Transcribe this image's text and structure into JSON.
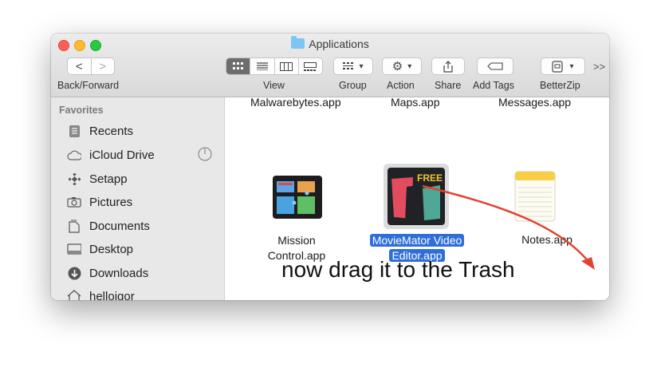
{
  "window": {
    "title": "Applications"
  },
  "toolbar": {
    "back_forward_label": "Back/Forward",
    "view_label": "View",
    "group_label": "Group",
    "action_label": "Action",
    "share_label": "Share",
    "add_tags_label": "Add Tags",
    "betterzip_label": "BetterZip",
    "overflow_label": ">>",
    "back_glyph": "<",
    "forward_glyph": ">"
  },
  "sidebar": {
    "section_title": "Favorites",
    "items": [
      {
        "label": "Recents",
        "icon": "recents-icon"
      },
      {
        "label": "iCloud Drive",
        "icon": "cloud-icon"
      },
      {
        "label": "Setapp",
        "icon": "setapp-icon"
      },
      {
        "label": "Pictures",
        "icon": "camera-icon"
      },
      {
        "label": "Documents",
        "icon": "document-icon"
      },
      {
        "label": "Desktop",
        "icon": "desktop-icon"
      },
      {
        "label": "Downloads",
        "icon": "download-icon"
      },
      {
        "label": "helloigor",
        "icon": "home-icon"
      }
    ]
  },
  "files": {
    "top_row": [
      "Malwarebytes.app",
      "Maps.app",
      "Messages.app"
    ],
    "mission_control": {
      "line1": "Mission",
      "line2": "Control.app"
    },
    "moviemator": {
      "line1": "MovieMator Video",
      "line2": "Editor.app",
      "badge": "FREE"
    },
    "notes": {
      "label": "Notes.app"
    }
  },
  "overlay": {
    "caption": "now drag it to the Trash",
    "arrow_color": "#e0432f"
  },
  "colors": {
    "selection": "#2f6ed8",
    "close": "#fc5f57",
    "minimize": "#fdbc2e",
    "zoom": "#28c840"
  }
}
